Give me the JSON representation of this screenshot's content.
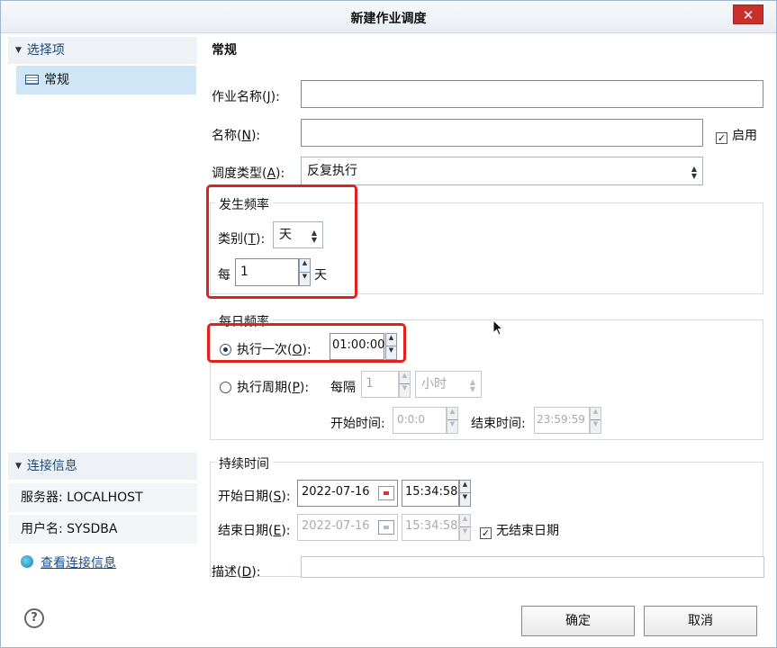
{
  "window": {
    "title": "新建作业调度",
    "close_glyph": "✕"
  },
  "left": {
    "select_header": "选择项",
    "selected_item": "常规",
    "conn_header": "连接信息",
    "server": "服务器: LOCALHOST",
    "user": "用户名: SYSDBA",
    "view_link": "查看连接信息"
  },
  "general": {
    "section_title": "常规",
    "job_name_label": "作业名称(",
    "job_name_key": "J",
    "job_name_value": "",
    "name_label": "名称(",
    "name_key": "N",
    "name_value": "",
    "enable_label": "启用",
    "enabled": true,
    "schedule_type_label": "调度类型(",
    "schedule_type_key": "A",
    "schedule_type_value": "反复执行"
  },
  "frequency": {
    "group_title": "发生频率",
    "category_label": "类别(",
    "category_key": "T",
    "category_value": "天",
    "every_label": "每",
    "every_value": "1",
    "every_unit": "天"
  },
  "daily": {
    "group_title": "每日频率",
    "once_label": "执行一次(",
    "once_key": "O",
    "once_time": "01:00:00",
    "periodic_label": "执行周期(",
    "periodic_key": "P",
    "every_label": "每隔",
    "every_value": "1",
    "unit_value": "小时",
    "start_label": "开始时间:",
    "start_value": "0:0:0",
    "end_label": "结束时间:",
    "end_value": "23:59:59",
    "selected": "once"
  },
  "duration": {
    "group_title": "持续时间",
    "start_label": "开始日期(",
    "start_key": "S",
    "start_date": "2022-07-16",
    "start_time": "15:34:58",
    "end_label": "结束日期(",
    "end_key": "E",
    "end_date": "2022-07-16",
    "end_time": "15:34:58",
    "no_end_label": "无结束日期",
    "no_end_checked": true
  },
  "description": {
    "label": "描述(",
    "key": "D",
    "value": ""
  },
  "buttons": {
    "ok": "确定",
    "cancel": "取消",
    "help": "?"
  },
  "icons": {
    "close": "close-icon",
    "help": "help-icon",
    "calendar": "calendar-icon",
    "connection": "connection-icon"
  }
}
